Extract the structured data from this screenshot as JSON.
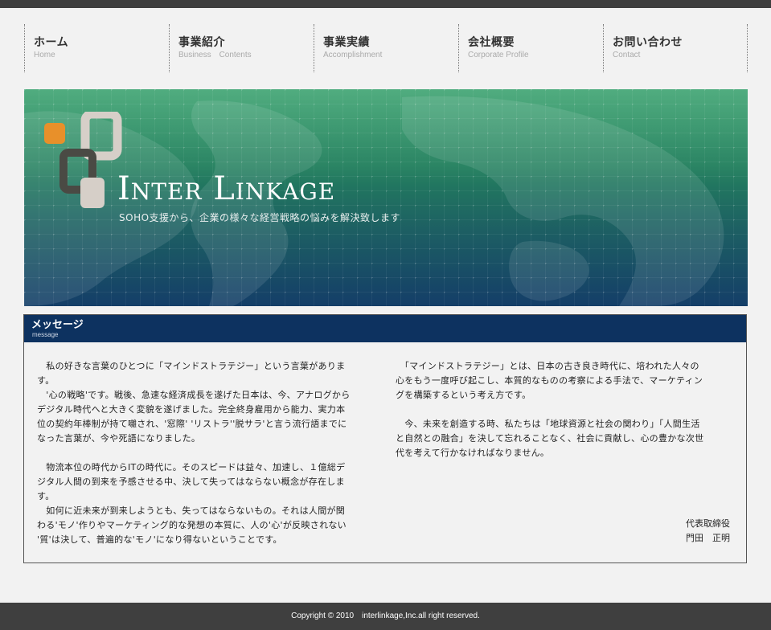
{
  "nav": {
    "items": [
      {
        "jp": "ホーム",
        "en": "Home"
      },
      {
        "jp": "事業紹介",
        "en": "Business　Contents"
      },
      {
        "jp": "事業実績",
        "en": "Accomplishment"
      },
      {
        "jp": "会社概要",
        "en": "Corporate Profile"
      },
      {
        "jp": "お問い合わせ",
        "en": "Contact"
      }
    ]
  },
  "hero": {
    "logo_text": "Inter Linkage",
    "tagline": "SOHO支援から、企業の様々な経営戦略の悩みを解決致します",
    "colors": {
      "top": "#2a9a63",
      "bottom": "#143e68",
      "logo_orange": "#e8902a",
      "logo_gray": "#d6cfc8",
      "logo_dark": "#4a4a44"
    }
  },
  "message": {
    "title": "メッセージ",
    "subtitle": "message",
    "left": [
      "　私の好きな言葉のひとつに「マインドストラテジー」という言葉がありま\nす。\n　'心の戦略'です。戦後、急速な経済成長を遂げた日本は、今、アナログから\nデジタル時代へと大きく変貌を遂げました。完全終身雇用から能力、実力本\n位の契約年棒制が持て囃され、'窓際' 'リストラ''脱サラ'と言う流行語までに\nなった言葉が、今や死語になりました。",
      "　物流本位の時代からITの時代に。そのスピードは益々、加速し、１億総デ\nジタル人間の到来を予感させる中、決して失ってはならない概念が存在しま\nす。\n　如何に近未来が到来しようとも、失ってはならないもの。それは人間が関\nわる'モノ'作りやマーケティング的な発想の本質に、人の'心'が反映されない\n'質'は決して、普遍的な'モノ'になり得ないということです。"
    ],
    "right": [
      "　「マインドストラテジー」とは、日本の古き良き時代に、培われた人々の\n心をもう一度呼び起こし、本質的なものの考察による手法で、マーケティン\nグを構築するという考え方です。",
      "　今、未来を創造する時、私たちは「地球資源と社会の関わり」「人間生活\nと自然との融合」を決して忘れることなく、社会に貢献し、心の豊かな次世\n代を考えて行かなければなりません。"
    ],
    "sign_role": "代表取締役",
    "sign_name": "門田　正明"
  },
  "footer": {
    "copyright": "Copyright © 2010　interlinkage,Inc.all right reserved."
  }
}
